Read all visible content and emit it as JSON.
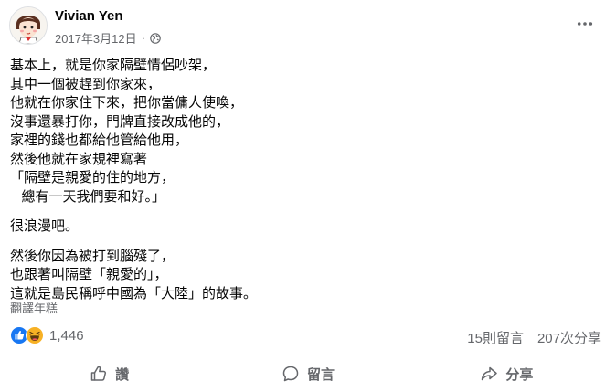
{
  "post": {
    "author": "Vivian Yen",
    "date": "2017年3月12日",
    "separator": "·",
    "paragraphs": [
      [
        "基本上，就是你家隔壁情侶吵架，",
        "其中一個被趕到你家來，",
        "他就在你家住下來，把你當傭人使喚，",
        "沒事還暴打你，門牌直接改成他的，",
        "家裡的錢也都給他管給他用，",
        "然後他就在家規裡寫著",
        "「隔壁是親愛的住的地方，",
        "   總有一天我們要和好。」"
      ],
      [
        "很浪漫吧。"
      ],
      [
        "然後你因為被打到腦殘了，",
        "也跟著叫隔壁「親愛的」，",
        "這就是島民稱呼中國為「大陸」的故事。"
      ]
    ],
    "translate_label": "翻譯年糕"
  },
  "reactions": {
    "types": [
      "like-icon",
      "haha-icon"
    ],
    "count": "1,446",
    "comments": "15則留言",
    "shares": "207次分享"
  },
  "actions": {
    "like": "讚",
    "comment": "留言",
    "share": "分享"
  },
  "colors": {
    "text": "#050505",
    "secondary": "#65676b",
    "like_blue": "#1877f2",
    "haha_yellow": "#f7b125",
    "divider": "#ced0d4"
  }
}
